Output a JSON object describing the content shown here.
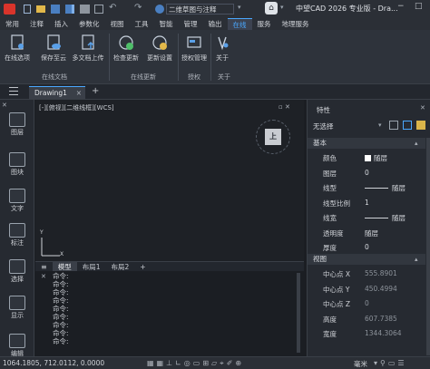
{
  "titlebar": {
    "workspace": "二维草图与注释",
    "app_title": "中望CAD 2026 专业版 - Dra..."
  },
  "menu": [
    "常用",
    "注释",
    "插入",
    "参数化",
    "视图",
    "工具",
    "智能",
    "管理",
    "输出",
    "在线",
    "服务",
    "地理服务"
  ],
  "menu_active_index": 9,
  "ribbon": {
    "buttons": [
      "在线选项",
      "保存至云",
      "多文档上传",
      "检查更新",
      "更新设置",
      "授权管理",
      "关于"
    ],
    "groups": [
      "在线文档",
      "在线更新",
      "授权",
      "关于"
    ]
  },
  "doc_tab": {
    "label": "Drawing1",
    "add": "+"
  },
  "left_tools": [
    "图层",
    "图块",
    "文字",
    "标注",
    "选择",
    "显示",
    "编辑"
  ],
  "canvas": {
    "viewport_label": "[-][俯视][二维线框][WCS]",
    "viewcube_label": "上",
    "axis_x": "X",
    "axis_y": "Y"
  },
  "model_tabs": [
    "模型",
    "布局1",
    "布局2",
    "+"
  ],
  "command_lines": [
    "命令:",
    "命令:",
    "命令:",
    "命令:",
    "命令:",
    "命令:",
    "命令:",
    "命令:",
    "命令:"
  ],
  "status": {
    "coords": "1064.1805, 712.0112, 0.0000",
    "unit": "毫米"
  },
  "properties": {
    "title": "特性",
    "selection": "无选择",
    "sections": [
      "基本",
      "视图"
    ],
    "basic": [
      {
        "key": "颜色",
        "value": "随层",
        "swatch": true
      },
      {
        "key": "图层",
        "value": "0"
      },
      {
        "key": "线型",
        "value": "随层",
        "line": true
      },
      {
        "key": "线型比例",
        "value": "1"
      },
      {
        "key": "线宽",
        "value": "随层",
        "line": true
      },
      {
        "key": "透明度",
        "value": "随层"
      },
      {
        "key": "厚度",
        "value": "0"
      }
    ],
    "view": [
      {
        "key": "中心点 X",
        "value": "555.8901"
      },
      {
        "key": "中心点 Y",
        "value": "450.4994"
      },
      {
        "key": "中心点 Z",
        "value": "0"
      },
      {
        "key": "高度",
        "value": "607.7385"
      },
      {
        "key": "宽度",
        "value": "1344.3064"
      }
    ]
  },
  "colors": {
    "accent": "#4aa8ff",
    "bg": "#1b1e23"
  }
}
